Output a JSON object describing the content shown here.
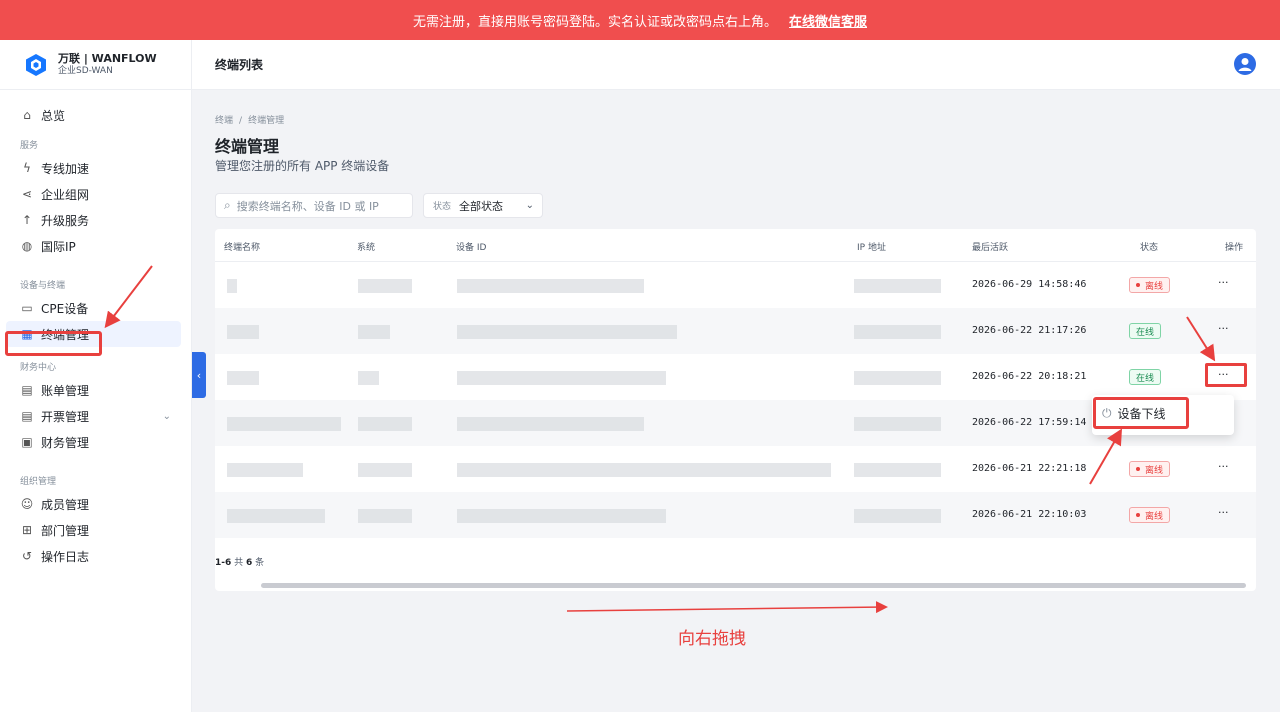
{
  "banner": {
    "text": "无需注册，直接用账号密码登陆。实名认证或改密码点右上角。",
    "link": "在线微信客服"
  },
  "brand": {
    "name": "万联 | WANFLOW",
    "sub": "企业SD-WAN"
  },
  "sidebar": {
    "overview": "总览",
    "group_service": "服务",
    "service_items": [
      "专线加速",
      "企业组网",
      "升级服务",
      "国际IP"
    ],
    "group_devices": "设备与终端",
    "device_items": [
      "CPE设备",
      "终端管理"
    ],
    "group_finance": "财务中心",
    "finance_items": [
      "账单管理",
      "开票管理",
      "财务管理"
    ],
    "group_org": "组织管理",
    "org_items": [
      "成员管理",
      "部门管理",
      "操作日志"
    ]
  },
  "header": {
    "title": "终端列表"
  },
  "breadcrumb": {
    "root": "终端",
    "current": "终端管理"
  },
  "page": {
    "title": "终端管理",
    "subtitle": "管理您注册的所有 APP 终端设备"
  },
  "filters": {
    "search_placeholder": "搜索终端名称、设备 ID 或 IP",
    "status_label": "状态",
    "status_value": "全部状态"
  },
  "table": {
    "columns": [
      "终端名称",
      "系统",
      "设备 ID",
      "IP 地址",
      "最后活跃",
      "状态",
      "操作"
    ],
    "rows": [
      {
        "last_active": "2026-06-29 14:58:46",
        "status": "离线",
        "status_type": "offline"
      },
      {
        "last_active": "2026-06-22 21:17:26",
        "status": "在线",
        "status_type": "online"
      },
      {
        "last_active": "2026-06-22 20:18:21",
        "status": "在线",
        "status_type": "online"
      },
      {
        "last_active": "2026-06-22 17:59:14",
        "status": "",
        "status_type": ""
      },
      {
        "last_active": "2026-06-21 22:21:18",
        "status": "离线",
        "status_type": "offline"
      },
      {
        "last_active": "2026-06-21 22:10:03",
        "status": "离线",
        "status_type": "offline"
      }
    ],
    "ops_label": "···",
    "pager": {
      "range": "1-6",
      "total_prefix": "共",
      "total": "6",
      "total_suffix": "条"
    }
  },
  "dropdown": {
    "item": "设备下线"
  },
  "hint": "向右拖拽",
  "colors": {
    "accent": "#2d6be4",
    "annotation": "#e8403e",
    "banner": "#f04e4e"
  }
}
